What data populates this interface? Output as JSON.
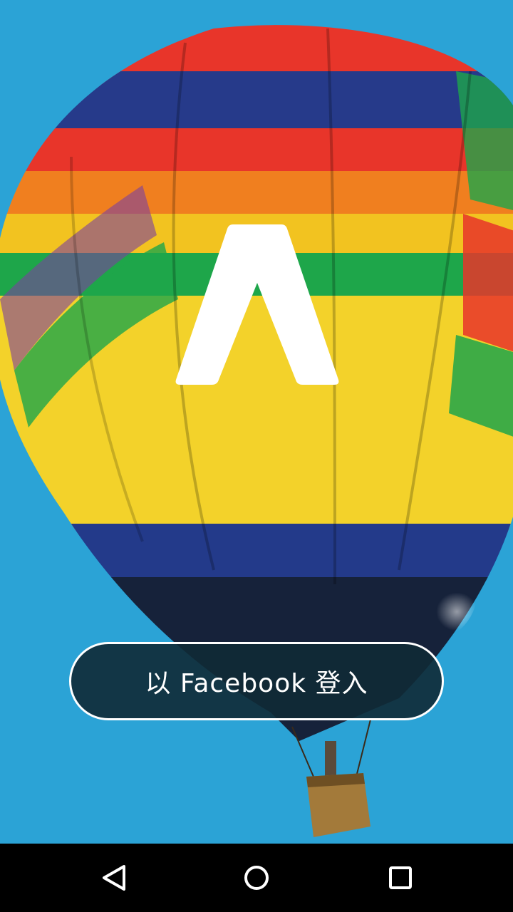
{
  "login": {
    "facebook_button_label": "以 Facebook 登入"
  },
  "icons": {
    "logo": "app-logo-a-icon",
    "back": "back-triangle-icon",
    "home": "home-circle-icon",
    "recents": "recents-square-icon"
  },
  "colors": {
    "sky": "#2ba3d6",
    "button_background": "#102a36",
    "button_border": "#ffffff",
    "navbar": "#000000"
  }
}
